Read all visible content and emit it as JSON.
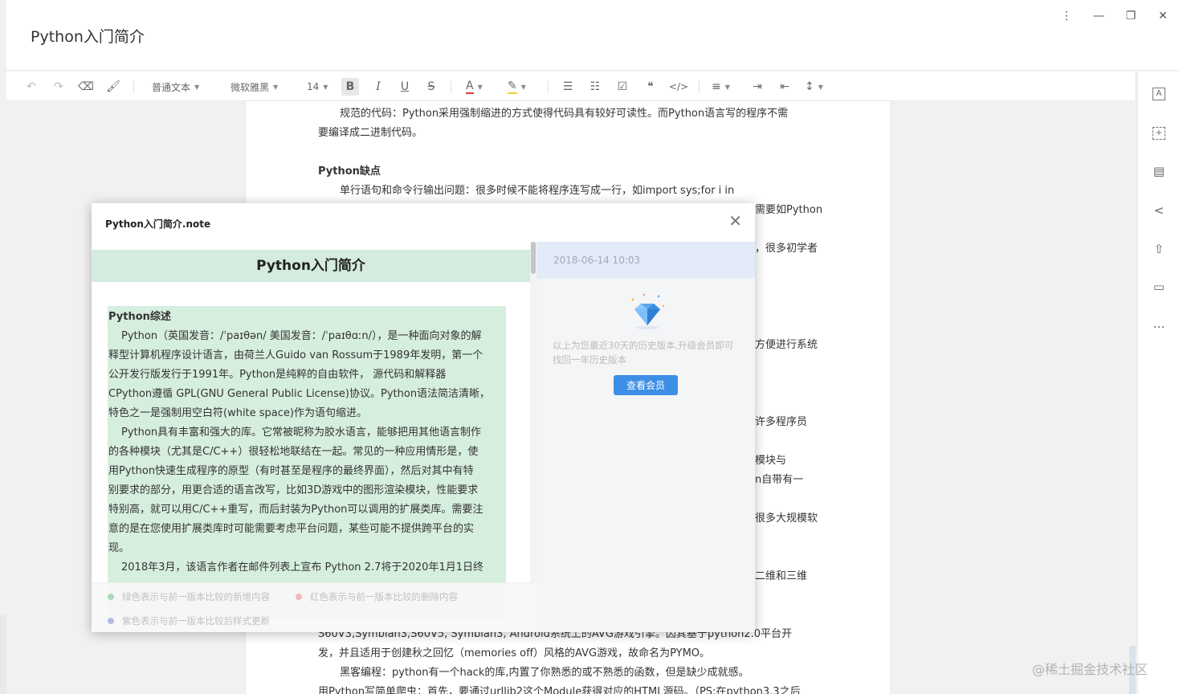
{
  "doc": {
    "title": "Python入门简介"
  },
  "window": {
    "menu": "⋮",
    "minimize": "—",
    "restore": "❐",
    "close": "✕"
  },
  "toolbar": {
    "undo": "↶",
    "redo": "↷",
    "clear_format": "⌫",
    "format_painter": "🖌",
    "paragraph_style": "普通文本",
    "font_family": "微软雅黑",
    "font_size": "14",
    "bold": "B",
    "italic": "I",
    "underline": "U",
    "strike": "S",
    "font_color": "A",
    "highlight": "✎",
    "bullet_list": "☰",
    "ordered_list": "☷",
    "checkbox": "☑",
    "quote": "❝",
    "code": "</>",
    "align": "≡",
    "indent": "⇥",
    "outdent": "⇤",
    "line_height": "↕"
  },
  "right_sidebar": {
    "icons": [
      "A",
      "+",
      "▤",
      "<",
      "⇧",
      "▭",
      "…"
    ]
  },
  "paper_lines": [
    "规范的代码：Python采用强制缩进的方式使得代码具有较好可读性。而Python语言写的程序不需",
    "要编译成二进制代码。",
    "Python缺点",
    "单行语句和命令行输出问题：很多时候不能将程序连写成一行，如import sys;for i in",
    "需要如Python",
    "，很多初学者",
    "方便进行系统",
    "许多程序员",
    "模块与",
    "n自带有一",
    "很多大规模软",
    "二维和三维",
    "S60V3,Symbian3,S60V5, Symbian3, Android系统上的AVG游戏引擎。因其基于python2.0平台开",
    "发，并且适用于创建秋之回忆（memories off）风格的AVG游戏，故命名为PYMO。",
    "黑客编程：python有一个hack的库,内置了你熟悉的或不熟悉的函数，但是缺少成就感。",
    "用Python写简单爬虫：首先，要通过urllib2这个Module获得对应的HTML源码。（PS:在python3.3之后"
  ],
  "modal": {
    "title": "Python入门简介.note",
    "close": "✕",
    "doc_heading": "Python入门简介",
    "content": [
      "Python综述",
      "Python（英国发音：/ˈpaɪθən/ 美国发音：/ˈpaɪθɑːn/），是一种面向对象的解",
      "释型计算机程序设计语言，由荷兰人Guido van Rossum于1989年发明，第一个",
      "公开发行版发行于1991年。Python是纯粹的自由软件， 源代码和解释器",
      "CPython遵循 GPL(GNU General Public License)协议。Python语法简洁清晰，",
      "特色之一是强制用空白符(white space)作为语句缩进。",
      "Python具有丰富和强大的库。它常被昵称为胶水语言，能够把用其他语言制作",
      "的各种模块（尤其是C/C++）很轻松地联结在一起。常见的一种应用情形是，使",
      "用Python快速生成程序的原型（有时甚至是程序的最终界面），然后对其中有特",
      "别要求的部分，用更合适的语言改写，比如3D游戏中的图形渲染模块，性能要求",
      "特别高，就可以用C/C++重写，而后封装为Python可以调用的扩展类库。需要注",
      "意的是在您使用扩展类库时可能需要考虑平台问题，某些可能不提供跨平台的实",
      "现。",
      "2018年3月，该语言作者在邮件列表上宣布 Python 2.7将于2020年1月1日终"
    ],
    "legend": {
      "green": "绿色表示与前一版本比较的新增内容",
      "red": "红色表示与前一版本比较的删除内容",
      "purple": "紫色表示与前一版本比较后样式更新",
      "green_color": "#a8dcbb",
      "red_color": "#f3b7bf",
      "purple_color": "#b4b9ea"
    },
    "version": {
      "date": "2018-06-14 10:03",
      "notice": "以上为您最近30天的历史版本,升级会员即可找回一年历史版本",
      "button": "查看会员"
    }
  },
  "watermark": "@稀土掘金技术社区"
}
